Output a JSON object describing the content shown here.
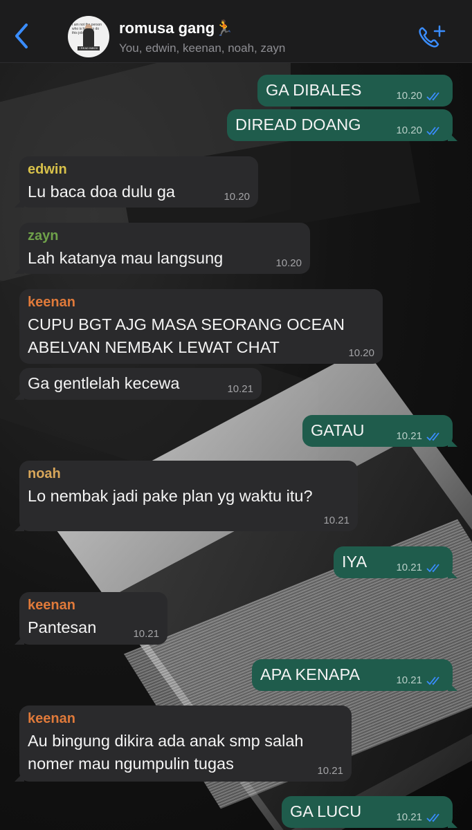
{
  "header": {
    "title": "romusa gang",
    "title_emoji": "🏃",
    "subtitle": "You, edwin, keenan, noah, zayn",
    "avatar_caption": "I am not the person who is hired to do this job",
    "avatar_badge": "I READ INBOX",
    "back_icon": "chevron-left-icon",
    "call_icon": "add-call-icon"
  },
  "colors": {
    "header_bg": "#1c1c1d",
    "incoming_bubble": "#2a2a2c",
    "outgoing_bubble": "#1f5c4c",
    "accent_blue": "#3a8dff",
    "edwin": "#d8c14a",
    "zayn": "#6fa14a",
    "keenan": "#e07a3a",
    "noah": "#d8a65a"
  },
  "messages": [
    {
      "dir": "out",
      "text": "GA DIBALES",
      "time": "10.20",
      "status": "read"
    },
    {
      "dir": "out",
      "text": "DIREAD DOANG",
      "time": "10.20",
      "status": "read"
    },
    {
      "dir": "in",
      "sender": "edwin",
      "text": "Lu baca doa dulu ga",
      "time": "10.20"
    },
    {
      "dir": "in",
      "sender": "zayn",
      "text": "Lah katanya mau langsung",
      "time": "10.20"
    },
    {
      "dir": "in",
      "sender": "keenan",
      "text": "CUPU BGT AJG MASA SEORANG OCEAN\nABELVAN NEMBAK LEWAT CHAT",
      "time": "10.20"
    },
    {
      "dir": "in",
      "text": "Ga gentlelah kecewa",
      "time": "10.21"
    },
    {
      "dir": "out",
      "text": "GATAU",
      "time": "10.21",
      "status": "read"
    },
    {
      "dir": "in",
      "sender": "noah",
      "text": "Lo nembak jadi pake plan yg waktu itu?",
      "time": "10.21"
    },
    {
      "dir": "out",
      "text": "IYA",
      "time": "10.21",
      "status": "read"
    },
    {
      "dir": "in",
      "sender": "keenan",
      "text": "Pantesan",
      "time": "10.21"
    },
    {
      "dir": "out",
      "text": "APA KENAPA",
      "time": "10.21",
      "status": "read"
    },
    {
      "dir": "in",
      "sender": "keenan",
      "text": "Au bingung dikira ada anak smp salah\nnomer mau ngumpulin tugas",
      "time": "10.21"
    },
    {
      "dir": "out",
      "text": "GA LUCU",
      "time": "10.21",
      "status": "read"
    }
  ]
}
